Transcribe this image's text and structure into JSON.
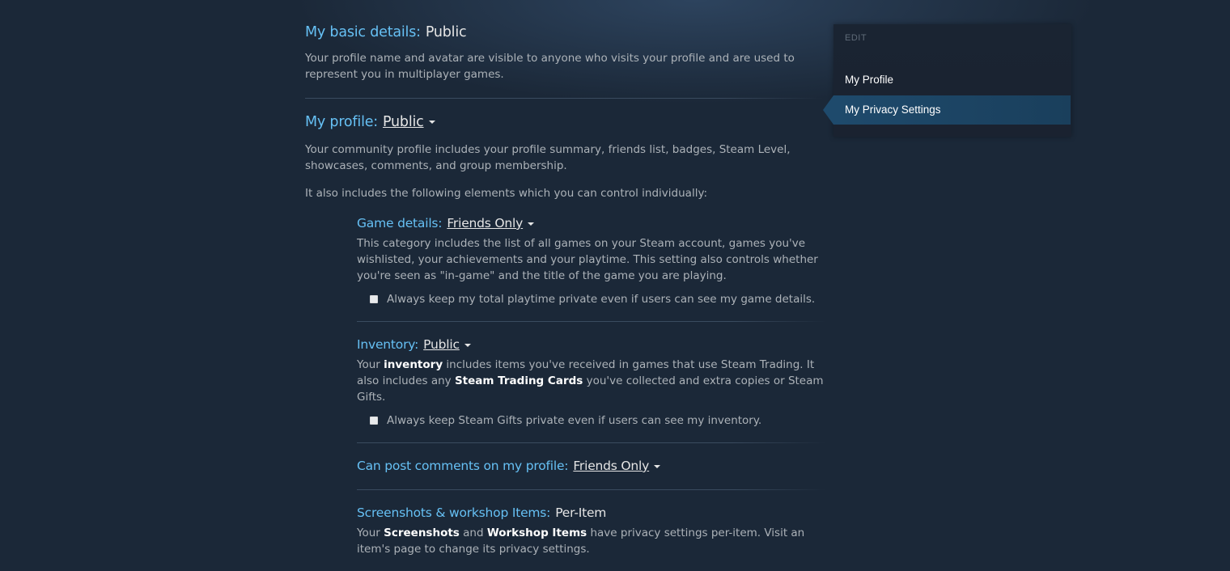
{
  "basic_details": {
    "label": "My basic details:",
    "value": "Public",
    "description": "Your profile name and avatar are visible to anyone who visits your profile and are used to represent you in multiplayer games."
  },
  "profile": {
    "label": "My profile:",
    "value": "Public",
    "description": "Your community profile includes your profile summary, friends list, badges, Steam Level, showcases, comments, and group membership.",
    "sub_intro": "It also includes the following elements which you can control individually:"
  },
  "game_details": {
    "label": "Game details:",
    "value": "Friends Only",
    "description": "This category includes the list of all games on your Steam account, games you've wishlisted, your achievements and your playtime. This setting also controls whether you're seen as \"in-game\" and the title of the game you are playing.",
    "checkbox_label": "Always keep my total playtime private even if users can see my game details.",
    "checkbox_checked": false
  },
  "inventory": {
    "label": "Inventory:",
    "value": "Public",
    "desc_1": "Your ",
    "desc_bold_1": "inventory",
    "desc_2": " includes items you've received in games that use Steam Trading. It also includes any ",
    "desc_bold_2": "Steam Trading Cards",
    "desc_3": " you've collected and extra copies or Steam Gifts.",
    "checkbox_label": "Always keep Steam Gifts private even if users can see my inventory.",
    "checkbox_checked": false
  },
  "comments": {
    "label": "Can post comments on my profile:",
    "value": "Friends Only"
  },
  "screenshots": {
    "label": "Screenshots & workshop Items:",
    "value": "Per-Item",
    "desc_1": "Your ",
    "desc_bold_1": "Screenshots",
    "desc_2": " and ",
    "desc_bold_2": "Workshop Items",
    "desc_3": " have privacy settings per-item. Visit an item's page to change its privacy settings."
  },
  "sidebar": {
    "header": "EDIT",
    "items": [
      {
        "label": "My Profile",
        "active": false
      },
      {
        "label": "My Privacy Settings",
        "active": true
      }
    ]
  }
}
